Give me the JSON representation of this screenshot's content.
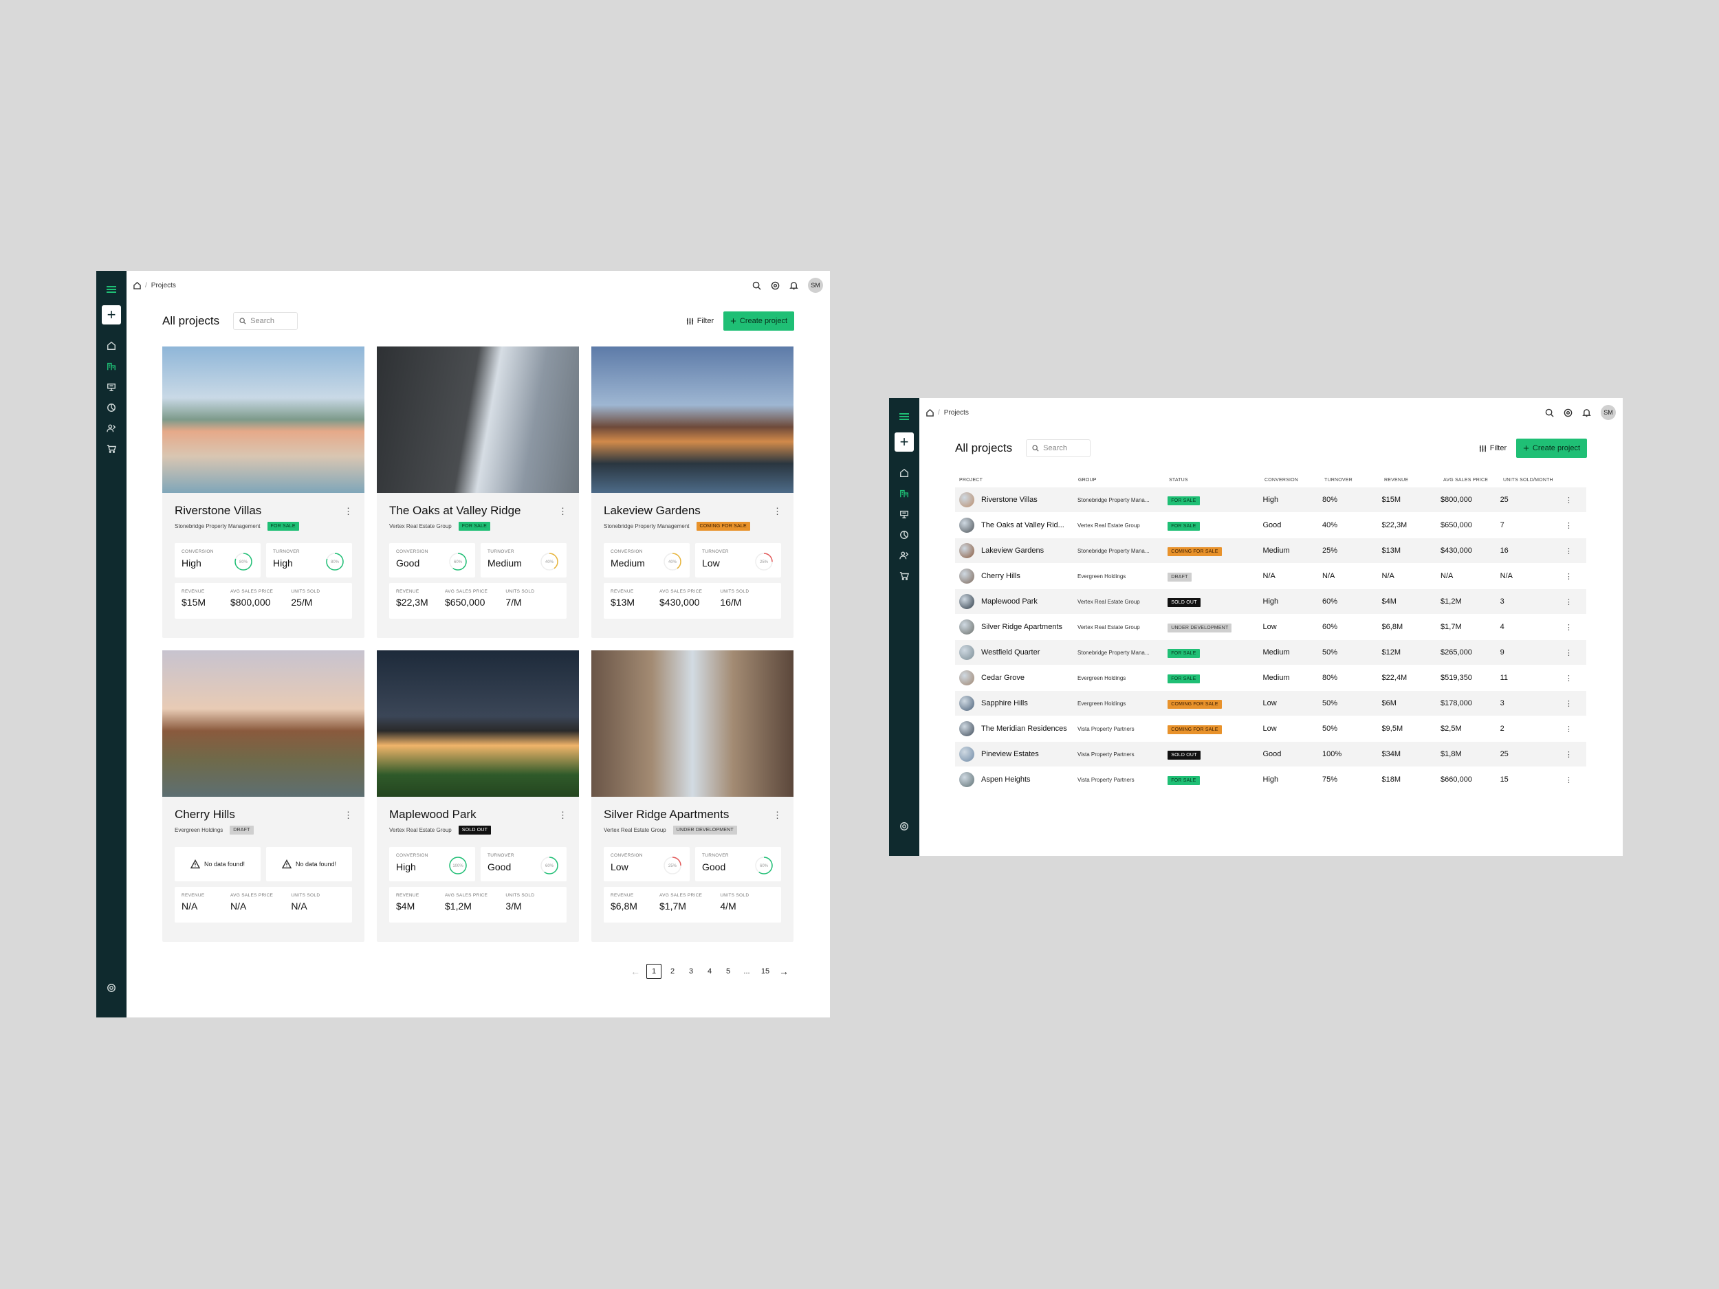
{
  "breadcrumb": {
    "current": "Projects"
  },
  "user": {
    "initials": "SM"
  },
  "page": {
    "title": "All projects",
    "search_placeholder": "Search",
    "filter_label": "Filter",
    "create_label": "Create project"
  },
  "cards": [
    {
      "name": "Riverstone Villas",
      "group": "Stonebridge Property Management",
      "status": "FOR SALE",
      "status_kind": "sale",
      "conversion": "High",
      "conversion_pct": "80%",
      "conversion_color": "#1fbf75",
      "turnover": "High",
      "turnover_pct": "80%",
      "turnover_color": "#1fbf75",
      "revenue": "$15M",
      "avg_price": "$800,000",
      "units": "25/M"
    },
    {
      "name": "The Oaks at Valley Ridge",
      "group": "Vertex Real Estate Group",
      "status": "FOR SALE",
      "status_kind": "sale",
      "conversion": "Good",
      "conversion_pct": "60%",
      "conversion_color": "#1fbf75",
      "turnover": "Medium",
      "turnover_pct": "40%",
      "turnover_color": "#e8b53a",
      "revenue": "$22,3M",
      "avg_price": "$650,000",
      "units": "7/M"
    },
    {
      "name": "Lakeview Gardens",
      "group": "Stonebridge Property Management",
      "status": "COMING FOR SALE",
      "status_kind": "soon",
      "conversion": "Medium",
      "conversion_pct": "40%",
      "conversion_color": "#e8b53a",
      "turnover": "Low",
      "turnover_pct": "25%",
      "turnover_color": "#e35a5a",
      "revenue": "$13M",
      "avg_price": "$430,000",
      "units": "16/M"
    },
    {
      "name": "Cherry Hills",
      "group": "Evergreen Holdings",
      "status": "DRAFT",
      "status_kind": "draft",
      "nodata": "No data found!",
      "revenue": "N/A",
      "avg_price": "N/A",
      "units": "N/A"
    },
    {
      "name": "Maplewood Park",
      "group": "Vertex Real Estate Group",
      "status": "SOLD OUT",
      "status_kind": "sold",
      "conversion": "High",
      "conversion_pct": "100%",
      "conversion_color": "#1fbf75",
      "turnover": "Good",
      "turnover_pct": "60%",
      "turnover_color": "#1fbf75",
      "revenue": "$4M",
      "avg_price": "$1,2M",
      "units": "3/M"
    },
    {
      "name": "Silver Ridge Apartments",
      "group": "Vertex Real Estate Group",
      "status": "UNDER DEVELOPMENT",
      "status_kind": "dev",
      "conversion": "Low",
      "conversion_pct": "25%",
      "conversion_color": "#e35a5a",
      "turnover": "Good",
      "turnover_pct": "60%",
      "turnover_color": "#1fbf75",
      "revenue": "$6,8M",
      "avg_price": "$1,7M",
      "units": "4/M"
    }
  ],
  "labels": {
    "conversion": "CONVERSION",
    "turnover": "TURNOVER",
    "revenue": "REVENUE",
    "avg_price": "AVG SALES PRICE",
    "units": "UNITS SOLD"
  },
  "pagination": {
    "pages": [
      "1",
      "2",
      "3",
      "4",
      "5",
      "...",
      "15"
    ],
    "current": "1"
  },
  "table": {
    "headers": [
      "PROJECT",
      "GROUP",
      "STATUS",
      "CONVERSION",
      "TURNOVER",
      "REVENUE",
      "AVG SALES PRICE",
      "UNITS SOLD/MONTH"
    ],
    "rows": [
      {
        "name": "Riverstone Villas",
        "group": "Stonebridge Property Mana...",
        "status": "FOR SALE",
        "kind": "sale",
        "conversion": "High",
        "turnover": "80%",
        "revenue": "$15M",
        "avg": "$800,000",
        "units": "25"
      },
      {
        "name": "The Oaks at Valley Rid...",
        "group": "Vertex Real Estate Group",
        "status": "FOR SALE",
        "kind": "sale",
        "conversion": "Good",
        "turnover": "40%",
        "revenue": "$22,3M",
        "avg": "$650,000",
        "units": "7"
      },
      {
        "name": "Lakeview Gardens",
        "group": "Stonebridge Property Mana...",
        "status": "COMING FOR SALE",
        "kind": "soon",
        "conversion": "Medium",
        "turnover": "25%",
        "revenue": "$13M",
        "avg": "$430,000",
        "units": "16"
      },
      {
        "name": "Cherry Hills",
        "group": "Evergreen Holdings",
        "status": "DRAFT",
        "kind": "draft",
        "conversion": "N/A",
        "turnover": "N/A",
        "revenue": "N/A",
        "avg": "N/A",
        "units": "N/A"
      },
      {
        "name": "Maplewood Park",
        "group": "Vertex Real Estate Group",
        "status": "SOLD OUT",
        "kind": "sold",
        "conversion": "High",
        "turnover": "60%",
        "revenue": "$4M",
        "avg": "$1,2M",
        "units": "3"
      },
      {
        "name": "Silver Ridge Apartments",
        "group": "Vertex Real Estate Group",
        "status": "UNDER DEVELOPMENT",
        "kind": "dev",
        "conversion": "Low",
        "turnover": "60%",
        "revenue": "$6,8M",
        "avg": "$1,7M",
        "units": "4"
      },
      {
        "name": "Westfield Quarter",
        "group": "Stonebridge Property Mana...",
        "status": "FOR SALE",
        "kind": "sale",
        "conversion": "Medium",
        "turnover": "50%",
        "revenue": "$12M",
        "avg": "$265,000",
        "units": "9"
      },
      {
        "name": "Cedar Grove",
        "group": "Evergreen Holdings",
        "status": "FOR SALE",
        "kind": "sale",
        "conversion": "Medium",
        "turnover": "80%",
        "revenue": "$22,4M",
        "avg": "$519,350",
        "units": "11"
      },
      {
        "name": "Sapphire Hills",
        "group": "Evergreen Holdings",
        "status": "COMING FOR SALE",
        "kind": "soon",
        "conversion": "Low",
        "turnover": "50%",
        "revenue": "$6M",
        "avg": "$178,000",
        "units": "3"
      },
      {
        "name": "The Meridian Residences",
        "group": "Vista Property Partners",
        "status": "COMING FOR SALE",
        "kind": "soon",
        "conversion": "Low",
        "turnover": "50%",
        "revenue": "$9,5M",
        "avg": "$2,5M",
        "units": "2"
      },
      {
        "name": "Pineview Estates",
        "group": "Vista Property Partners",
        "status": "SOLD OUT",
        "kind": "sold",
        "conversion": "Good",
        "turnover": "100%",
        "revenue": "$34M",
        "avg": "$1,8M",
        "units": "25"
      },
      {
        "name": "Aspen Heights",
        "group": "Vista Property Partners",
        "status": "FOR SALE",
        "kind": "sale",
        "conversion": "High",
        "turnover": "75%",
        "revenue": "$18M",
        "avg": "$660,000",
        "units": "15"
      }
    ]
  }
}
